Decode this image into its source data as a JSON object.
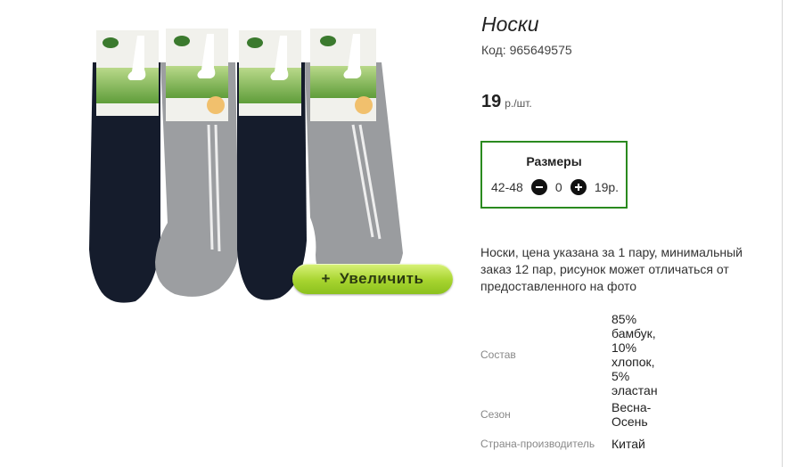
{
  "product": {
    "title": "Носки",
    "code": "Код: 965649575",
    "price": {
      "value": "19",
      "unit": "р./шт."
    },
    "zoom_button": {
      "label": "Увеличить",
      "icon": "plus-icon"
    },
    "sizes": {
      "title": "Размеры",
      "items": [
        {
          "size": "42-48",
          "quantity": "0",
          "price": "19р."
        }
      ]
    },
    "description": "Носки, цена указана за 1 пару, минимальный заказ 12 пар, рисунок может отличаться от предоставленного на фото",
    "properties": [
      {
        "name": "Состав",
        "value": "85% бамбук, 10% хлопок, 5% эластан"
      },
      {
        "name": "Сезон",
        "value": "Весна-Осень"
      },
      {
        "name": "Страна-производитель",
        "value": "Китай"
      }
    ]
  },
  "colors": {
    "sizes_border": "#2a8a1f",
    "zoom_button": "#a7d42f"
  }
}
